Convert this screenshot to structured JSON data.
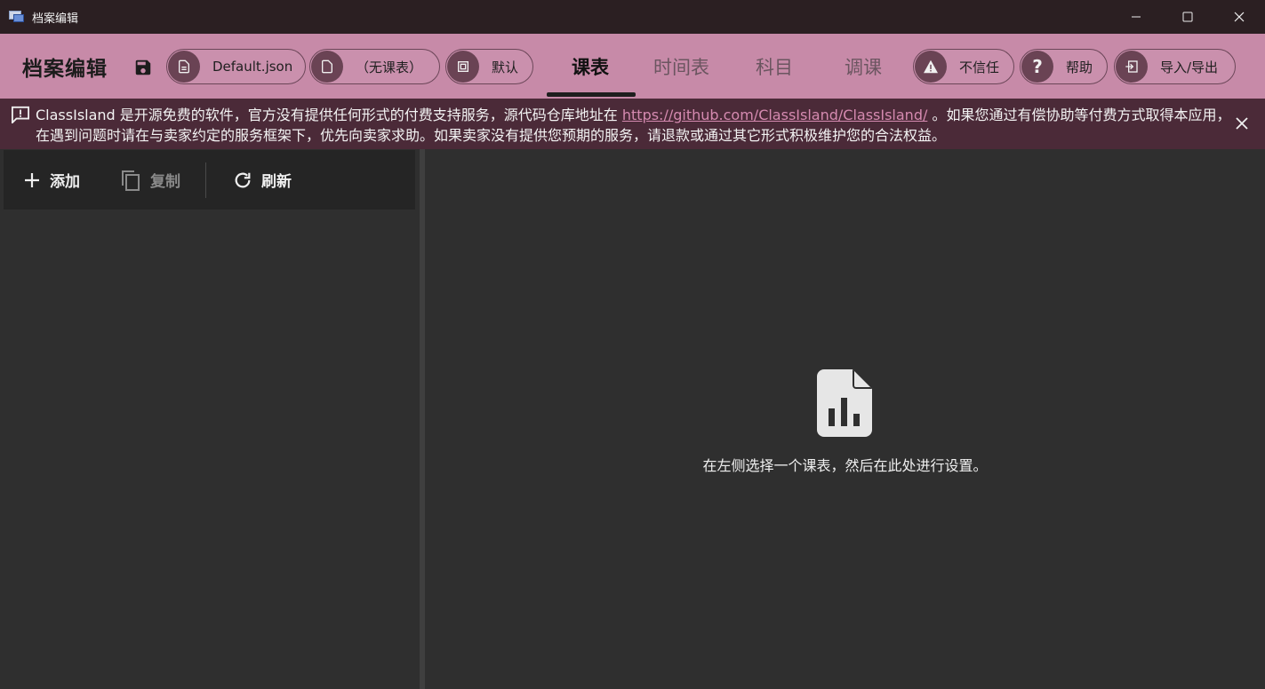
{
  "window": {
    "title": "档案编辑",
    "controls": [
      "minimize",
      "maximize",
      "close"
    ]
  },
  "header": {
    "heading": "档案编辑",
    "profile_chip": "Default.json",
    "classplan_chip": "（无课表）",
    "mode_chip": "默认",
    "tabs": [
      "课表",
      "时间表",
      "科目",
      "调课"
    ],
    "active_tab": "课表",
    "trust_chip": "不信任",
    "help_chip": "帮助",
    "import_export_chip": "导入/导出"
  },
  "banner": {
    "text_before": "ClassIsland 是开源免费的软件，官方没有提供任何形式的付费支持服务，源代码仓库地址在 ",
    "link": "https://github.com/ClassIsland/ClassIsland/",
    "text_after": " 。如果您通过有偿协助等付费方式取得本应用，在遇到问题时请在与卖家约定的服务框架下，优先向卖家求助。如果卖家没有提供您预期的服务，请退款或通过其它形式积极维护您的合法权益。"
  },
  "leftpanel": {
    "add_label": "添加",
    "copy_label": "复制",
    "refresh_label": "刷新"
  },
  "rightpanel": {
    "empty_message": "在左侧选择一个课表，然后在此处进行设置。"
  },
  "colors": {
    "accent": "#c78aa8",
    "banner": "#4b2a38",
    "chip_icon": "#6a4354",
    "panel": "#2f2f2f"
  },
  "icons": [
    "app-icon",
    "save-icon",
    "document-icon",
    "file-icon",
    "crop-icon",
    "warning-icon",
    "help-icon",
    "import-icon",
    "message-alert-icon",
    "close-icon",
    "plus-icon",
    "copy-icon",
    "refresh-icon",
    "file-chart-icon"
  ]
}
